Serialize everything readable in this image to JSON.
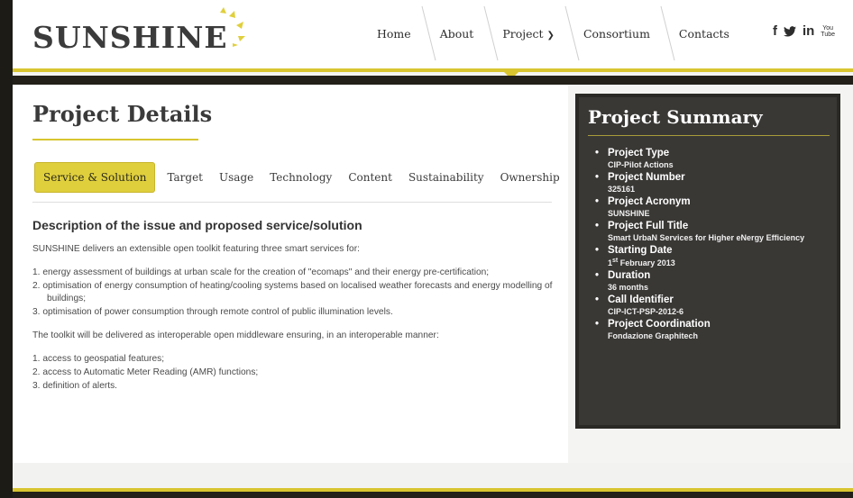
{
  "header": {
    "logo_text": "SUNSHINE",
    "nav": [
      {
        "label": "Home"
      },
      {
        "label": "About"
      },
      {
        "label": "Project"
      },
      {
        "label": "Consortium"
      },
      {
        "label": "Contacts"
      }
    ],
    "social": {
      "facebook": "f",
      "twitter": "t",
      "linkedin": "in",
      "youtube_top": "You",
      "youtube_bottom": "Tube"
    }
  },
  "main": {
    "title": "Project Details",
    "tabs": [
      {
        "label": "Service & Solution",
        "active": true
      },
      {
        "label": "Target"
      },
      {
        "label": "Usage"
      },
      {
        "label": "Technology"
      },
      {
        "label": "Content"
      },
      {
        "label": "Sustainability"
      },
      {
        "label": "Ownership"
      }
    ],
    "section_heading": "Description of the issue and proposed service/solution",
    "intro": "SUNSHINE delivers an extensible open toolkit featuring three smart services for:",
    "services": [
      "1.  energy assessment of buildings at urban scale for the creation of \"ecomaps\" and their energy pre-certification;",
      "2.  optimisation of energy consumption of heating/cooling systems based on localised weather forecasts and energy modelling of buildings;",
      "3.  optimisation of power consumption through remote control of public illumination levels."
    ],
    "toolkit_text": "The toolkit will be delivered as interoperable open middleware ensuring, in an interoperable manner:",
    "toolkit_items": [
      "1.  access to geospatial features;",
      "2.  access to Automatic Meter Reading (AMR) functions;",
      "3.  definition of alerts."
    ]
  },
  "sidebar": {
    "title": "Project Summary",
    "items": [
      {
        "label": "Project Type",
        "value": "CIP-Pilot Actions"
      },
      {
        "label": "Project Number",
        "value": "325161"
      },
      {
        "label": "Project Acronym",
        "value": "SUNSHINE"
      },
      {
        "label": "Project Full Title",
        "value": "Smart UrbaN Services for Higher eNergy Efficiency"
      },
      {
        "label": "Starting Date",
        "value_day": "1",
        "value_sup": "st",
        "value_rest": " February 2013"
      },
      {
        "label": "Duration",
        "value": "36 months"
      },
      {
        "label": "Call Identifier",
        "value": "CIP-ICT-PSP-2012-6"
      },
      {
        "label": "Project Coordination",
        "value": "Fondazione Graphitech"
      }
    ]
  },
  "colors": {
    "accent": "#d8c530",
    "dark": "#222018",
    "sidebar_bg": "#3a3835"
  }
}
